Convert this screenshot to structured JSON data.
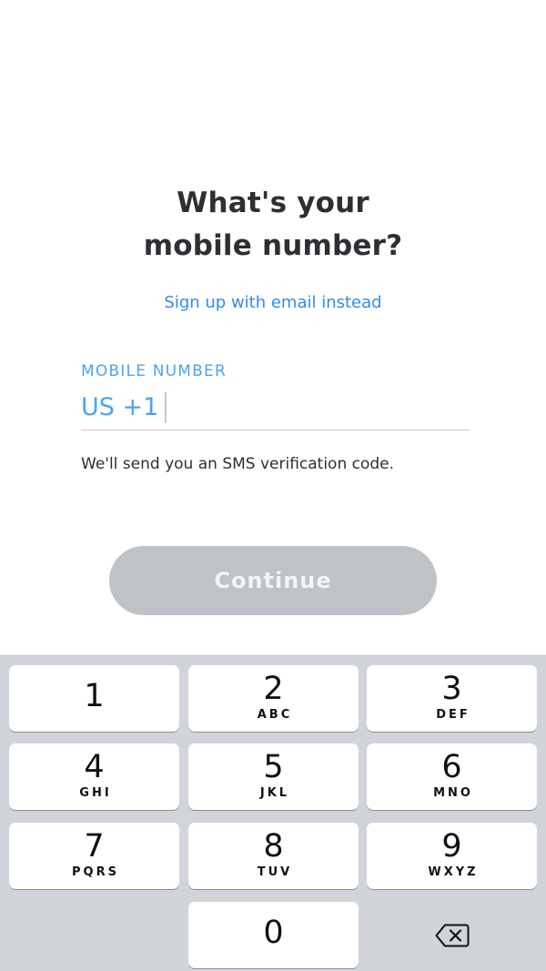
{
  "header": {
    "title_line1": "What's your",
    "title_line2": "mobile number?"
  },
  "email_link": "Sign up with email instead",
  "mobile_field": {
    "label": "MOBILE NUMBER",
    "country_prefix": "US +1",
    "value": ""
  },
  "helper_text": "We'll send you an SMS verification code.",
  "continue_button": {
    "label": "Continue",
    "enabled": false
  },
  "keypad": {
    "keys": [
      {
        "digit": "1",
        "letters": ""
      },
      {
        "digit": "2",
        "letters": "ABC"
      },
      {
        "digit": "3",
        "letters": "DEF"
      },
      {
        "digit": "4",
        "letters": "GHI"
      },
      {
        "digit": "5",
        "letters": "JKL"
      },
      {
        "digit": "6",
        "letters": "MNO"
      },
      {
        "digit": "7",
        "letters": "PQRS"
      },
      {
        "digit": "8",
        "letters": "TUV"
      },
      {
        "digit": "9",
        "letters": "WXYZ"
      },
      {
        "digit": "0",
        "letters": ""
      }
    ],
    "backspace_icon": "backspace-icon"
  },
  "colors": {
    "accent": "#2f8ce8",
    "field_accent": "#4da3ee",
    "button_disabled": "#bfc2c6",
    "keypad_bg": "#d1d4d9"
  }
}
